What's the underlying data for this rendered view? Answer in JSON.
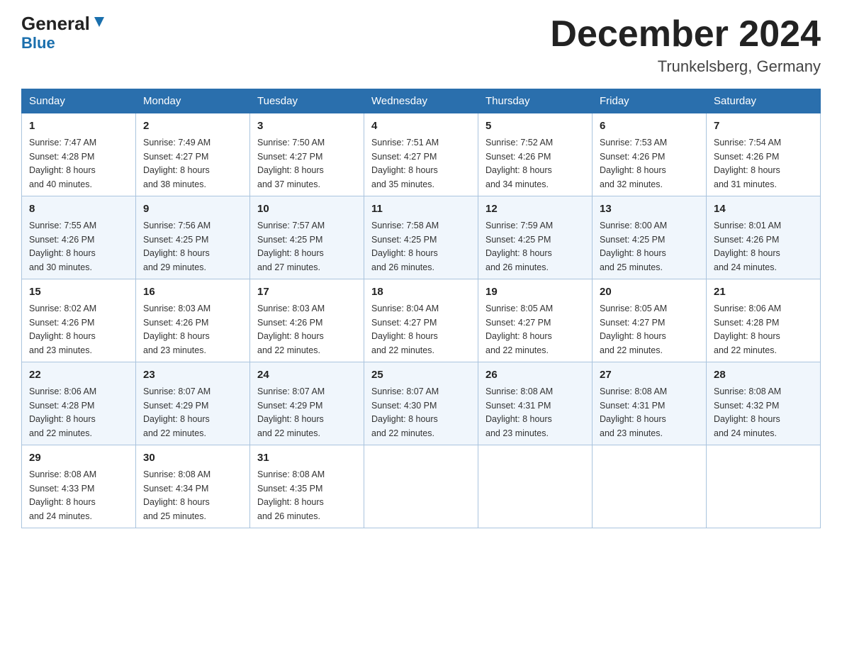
{
  "logo": {
    "general": "General",
    "blue": "Blue"
  },
  "title": "December 2024",
  "subtitle": "Trunkelsberg, Germany",
  "days_of_week": [
    "Sunday",
    "Monday",
    "Tuesday",
    "Wednesday",
    "Thursday",
    "Friday",
    "Saturday"
  ],
  "weeks": [
    [
      {
        "day": "1",
        "info": "Sunrise: 7:47 AM\nSunset: 4:28 PM\nDaylight: 8 hours\nand 40 minutes."
      },
      {
        "day": "2",
        "info": "Sunrise: 7:49 AM\nSunset: 4:27 PM\nDaylight: 8 hours\nand 38 minutes."
      },
      {
        "day": "3",
        "info": "Sunrise: 7:50 AM\nSunset: 4:27 PM\nDaylight: 8 hours\nand 37 minutes."
      },
      {
        "day": "4",
        "info": "Sunrise: 7:51 AM\nSunset: 4:27 PM\nDaylight: 8 hours\nand 35 minutes."
      },
      {
        "day": "5",
        "info": "Sunrise: 7:52 AM\nSunset: 4:26 PM\nDaylight: 8 hours\nand 34 minutes."
      },
      {
        "day": "6",
        "info": "Sunrise: 7:53 AM\nSunset: 4:26 PM\nDaylight: 8 hours\nand 32 minutes."
      },
      {
        "day": "7",
        "info": "Sunrise: 7:54 AM\nSunset: 4:26 PM\nDaylight: 8 hours\nand 31 minutes."
      }
    ],
    [
      {
        "day": "8",
        "info": "Sunrise: 7:55 AM\nSunset: 4:26 PM\nDaylight: 8 hours\nand 30 minutes."
      },
      {
        "day": "9",
        "info": "Sunrise: 7:56 AM\nSunset: 4:25 PM\nDaylight: 8 hours\nand 29 minutes."
      },
      {
        "day": "10",
        "info": "Sunrise: 7:57 AM\nSunset: 4:25 PM\nDaylight: 8 hours\nand 27 minutes."
      },
      {
        "day": "11",
        "info": "Sunrise: 7:58 AM\nSunset: 4:25 PM\nDaylight: 8 hours\nand 26 minutes."
      },
      {
        "day": "12",
        "info": "Sunrise: 7:59 AM\nSunset: 4:25 PM\nDaylight: 8 hours\nand 26 minutes."
      },
      {
        "day": "13",
        "info": "Sunrise: 8:00 AM\nSunset: 4:25 PM\nDaylight: 8 hours\nand 25 minutes."
      },
      {
        "day": "14",
        "info": "Sunrise: 8:01 AM\nSunset: 4:26 PM\nDaylight: 8 hours\nand 24 minutes."
      }
    ],
    [
      {
        "day": "15",
        "info": "Sunrise: 8:02 AM\nSunset: 4:26 PM\nDaylight: 8 hours\nand 23 minutes."
      },
      {
        "day": "16",
        "info": "Sunrise: 8:03 AM\nSunset: 4:26 PM\nDaylight: 8 hours\nand 23 minutes."
      },
      {
        "day": "17",
        "info": "Sunrise: 8:03 AM\nSunset: 4:26 PM\nDaylight: 8 hours\nand 22 minutes."
      },
      {
        "day": "18",
        "info": "Sunrise: 8:04 AM\nSunset: 4:27 PM\nDaylight: 8 hours\nand 22 minutes."
      },
      {
        "day": "19",
        "info": "Sunrise: 8:05 AM\nSunset: 4:27 PM\nDaylight: 8 hours\nand 22 minutes."
      },
      {
        "day": "20",
        "info": "Sunrise: 8:05 AM\nSunset: 4:27 PM\nDaylight: 8 hours\nand 22 minutes."
      },
      {
        "day": "21",
        "info": "Sunrise: 8:06 AM\nSunset: 4:28 PM\nDaylight: 8 hours\nand 22 minutes."
      }
    ],
    [
      {
        "day": "22",
        "info": "Sunrise: 8:06 AM\nSunset: 4:28 PM\nDaylight: 8 hours\nand 22 minutes."
      },
      {
        "day": "23",
        "info": "Sunrise: 8:07 AM\nSunset: 4:29 PM\nDaylight: 8 hours\nand 22 minutes."
      },
      {
        "day": "24",
        "info": "Sunrise: 8:07 AM\nSunset: 4:29 PM\nDaylight: 8 hours\nand 22 minutes."
      },
      {
        "day": "25",
        "info": "Sunrise: 8:07 AM\nSunset: 4:30 PM\nDaylight: 8 hours\nand 22 minutes."
      },
      {
        "day": "26",
        "info": "Sunrise: 8:08 AM\nSunset: 4:31 PM\nDaylight: 8 hours\nand 23 minutes."
      },
      {
        "day": "27",
        "info": "Sunrise: 8:08 AM\nSunset: 4:31 PM\nDaylight: 8 hours\nand 23 minutes."
      },
      {
        "day": "28",
        "info": "Sunrise: 8:08 AM\nSunset: 4:32 PM\nDaylight: 8 hours\nand 24 minutes."
      }
    ],
    [
      {
        "day": "29",
        "info": "Sunrise: 8:08 AM\nSunset: 4:33 PM\nDaylight: 8 hours\nand 24 minutes."
      },
      {
        "day": "30",
        "info": "Sunrise: 8:08 AM\nSunset: 4:34 PM\nDaylight: 8 hours\nand 25 minutes."
      },
      {
        "day": "31",
        "info": "Sunrise: 8:08 AM\nSunset: 4:35 PM\nDaylight: 8 hours\nand 26 minutes."
      },
      null,
      null,
      null,
      null
    ]
  ]
}
